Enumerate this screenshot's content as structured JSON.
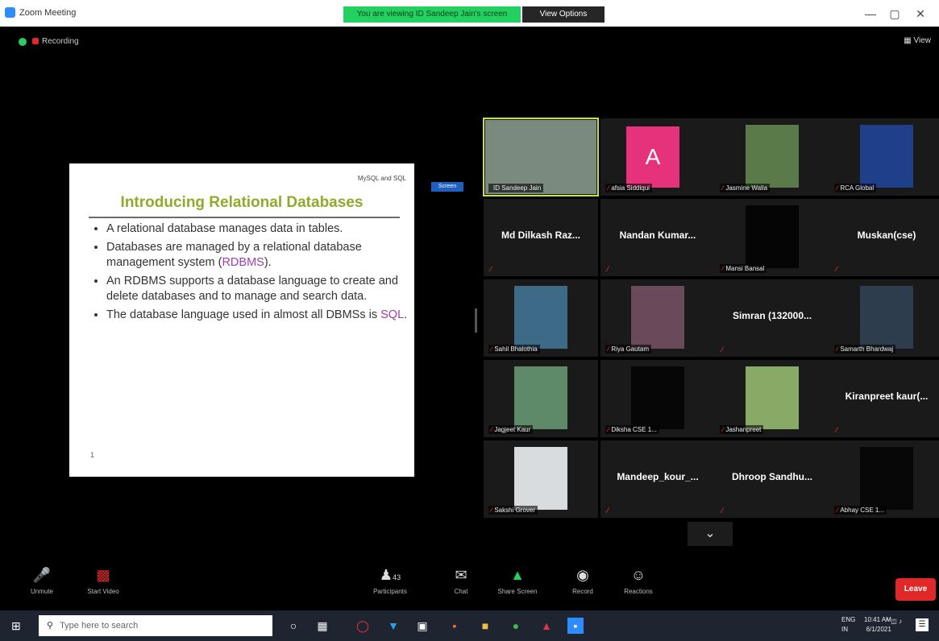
{
  "window": {
    "title": "Zoom Meeting",
    "share_banner": "You are viewing ID Sandeep Jain's screen",
    "view_options": "View Options",
    "minimize": "—",
    "restore": "▢",
    "close": "✕"
  },
  "header": {
    "recording": "Recording",
    "view": "View"
  },
  "slide": {
    "corner_label": "MySQL and SQL",
    "title": "Introducing Relational Databases",
    "bullet_1": "A relational database manages data in tables.",
    "bullet_2_pre": "Databases are managed by a relational database management system (",
    "bullet_2_hl": "RDBMS",
    "bullet_2_post": ").",
    "bullet_3": "An RDBMS supports a database language to create and delete databases and to manage and search data.",
    "bullet_4_pre": "The database language used in almost all DBMSs is ",
    "bullet_4_hl": "SQL",
    "bullet_4_post": ".",
    "page_number": "1",
    "share_tag": "Screen"
  },
  "gallery": {
    "tiles": [
      {
        "label": "ID Sandeep Jain",
        "kind": "video",
        "color": "#7b8a7e"
      },
      {
        "label": "afsia Siddiqui",
        "kind": "avatar",
        "initial": "A"
      },
      {
        "label": "Jasmine Walia",
        "kind": "video",
        "color": "#5a7a4a"
      },
      {
        "label": "RCA Global",
        "kind": "video",
        "color": "#1f3f8a"
      },
      {
        "label": "Md Dilkash Raz...",
        "kind": "name"
      },
      {
        "label": "Nandan Kumar...",
        "kind": "name"
      },
      {
        "label": "Mansi Bansal",
        "kind": "video",
        "color": "#050505"
      },
      {
        "label": "Muskan(cse)",
        "kind": "name"
      },
      {
        "label": "Sahil Bhalothia",
        "kind": "video",
        "color": "#3d6a87"
      },
      {
        "label": "Riya Gautam",
        "kind": "video",
        "color": "#6a4a5a"
      },
      {
        "label": "Simran (132000...",
        "kind": "name"
      },
      {
        "label": "Samarth Bhardwaj",
        "kind": "video",
        "color": "#2d3d4d"
      },
      {
        "label": "Jagjeet Kaur",
        "kind": "video",
        "color": "#5f8a6a"
      },
      {
        "label": "Diksha CSE 1...",
        "kind": "video",
        "color": "#060606"
      },
      {
        "label": "Jashanpreet",
        "kind": "video",
        "color": "#88aa66"
      },
      {
        "label": "Kiranpreet kaur(...",
        "kind": "name"
      },
      {
        "label": "Sakshi Grover",
        "kind": "video",
        "color": "#d9dcdf"
      },
      {
        "label": "Mandeep_kour_...",
        "kind": "name"
      },
      {
        "label": "Dhroop Sandhu...",
        "kind": "name"
      },
      {
        "label": "Abhay CSE 1...",
        "kind": "video",
        "color": "#070707"
      }
    ],
    "next_icon": "⌄"
  },
  "toolbar": {
    "unmute": "Unmute",
    "start_video": "Start Video",
    "participants": "Participants",
    "participant_count": "43",
    "chat": "Chat",
    "share_screen": "Share Screen",
    "record": "Record",
    "reactions": "Reactions",
    "end": "Leave"
  },
  "taskbar": {
    "search_placeholder": "Type here to search",
    "lang_top": "ENG",
    "lang_bottom": "IN",
    "time": "10:41 AM",
    "date": "6/1/2021"
  },
  "colors": {
    "accent_green": "#23d160",
    "end_red": "#e02828",
    "slide_title": "#8cac2a",
    "highlight_purple": "#9d3fae"
  }
}
